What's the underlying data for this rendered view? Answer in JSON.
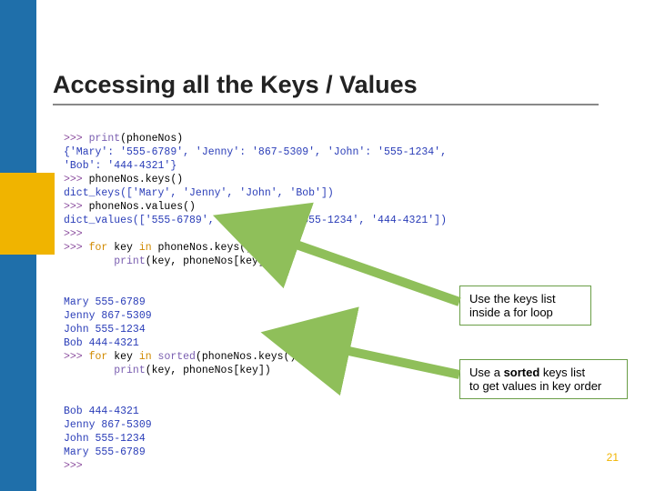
{
  "title": "Accessing all the Keys / Values",
  "code": {
    "l1a": ">>> ",
    "l1b": "print",
    "l1c": "(phoneNos)",
    "l2": "{'Mary': '555-6789', 'Jenny': '867-5309', 'John': '555-1234',",
    "l3": "'Bob': '444-4321'}",
    "l4a": ">>> ",
    "l4b": "phoneNos.keys()",
    "l5": "dict_keys(['Mary', 'Jenny', 'John', 'Bob'])",
    "l6a": ">>> ",
    "l6b": "phoneNos.values()",
    "l7": "dict_values(['555-6789', '867-5309', '555-1234', '444-4321'])",
    "l8": ">>> ",
    "l9a": ">>> ",
    "l9b": "for ",
    "l9c": "key ",
    "l9d": "in ",
    "l9e": "phoneNos.keys():",
    "l10a": "        ",
    "l10b": "print",
    "l10c": "(key, phoneNos[key])",
    "l11": "",
    "l12": "",
    "l13": "Mary 555-6789",
    "l14": "Jenny 867-5309",
    "l15": "John 555-1234",
    "l16": "Bob 444-4321",
    "l17a": ">>> ",
    "l17b": "for ",
    "l17c": "key ",
    "l17d": "in ",
    "l17e": "sorted",
    "l17f": "(phoneNos.keys()):",
    "l18a": "        ",
    "l18b": "print",
    "l18c": "(key, phoneNos[key])",
    "l19": "",
    "l20": "",
    "l21": "Bob 444-4321",
    "l22": "Jenny 867-5309",
    "l23": "John 555-1234",
    "l24": "Mary 555-6789",
    "l25": ">>> "
  },
  "callout1_line1": "Use the keys list",
  "callout1_line2": "inside a for loop",
  "callout2_a": "Use a ",
  "callout2_b": "sorted",
  "callout2_c": " keys list",
  "callout2_line2": "to get values in key order",
  "page_number": "21"
}
